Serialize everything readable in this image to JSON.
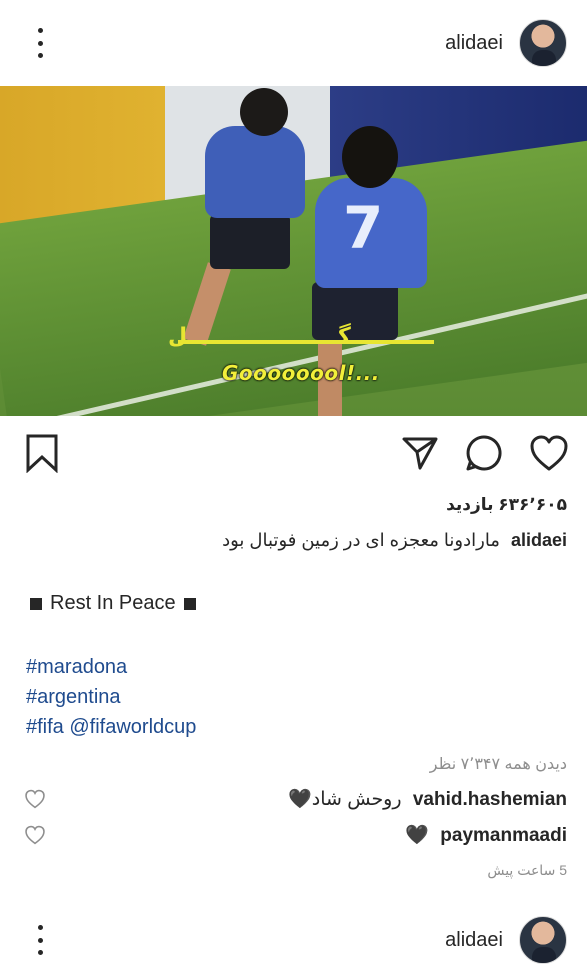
{
  "post1": {
    "username": "alidaei",
    "menu_icon": "more-vertical-icon",
    "video_caption_fa": "گــــــــــــــــــــل",
    "video_caption_en": "Goooooool!...",
    "video_jersey_number": "7"
  },
  "actions": {
    "save_icon": "bookmark-icon",
    "share_icon": "send-icon",
    "comment_icon": "comment-icon",
    "like_icon": "heart-icon"
  },
  "views": "۶۳۶٬۶۰۵ بازدید",
  "caption": {
    "username": "alidaei",
    "text": "مارادونا معجزه ای در زمین فوتبال بود"
  },
  "rip_text": "Rest In Peace",
  "hashtags": [
    "#maradona",
    "#argentina",
    "#fifa @fifaworldcup"
  ],
  "view_all_comments": "دیدن همه ۷٬۳۴۷ نظر",
  "comments": [
    {
      "username": "vahid.hashemian",
      "text": "روحش شاد🖤"
    },
    {
      "username": "paymanmaadi",
      "text": "🖤"
    }
  ],
  "timestamp": "5 ساعت پیش",
  "post2": {
    "username": "alidaei"
  },
  "colors": {
    "text": "#262626",
    "muted": "#8e8e8e",
    "link": "#1f4b8e",
    "caption_yellow": "#f2ef3a"
  }
}
